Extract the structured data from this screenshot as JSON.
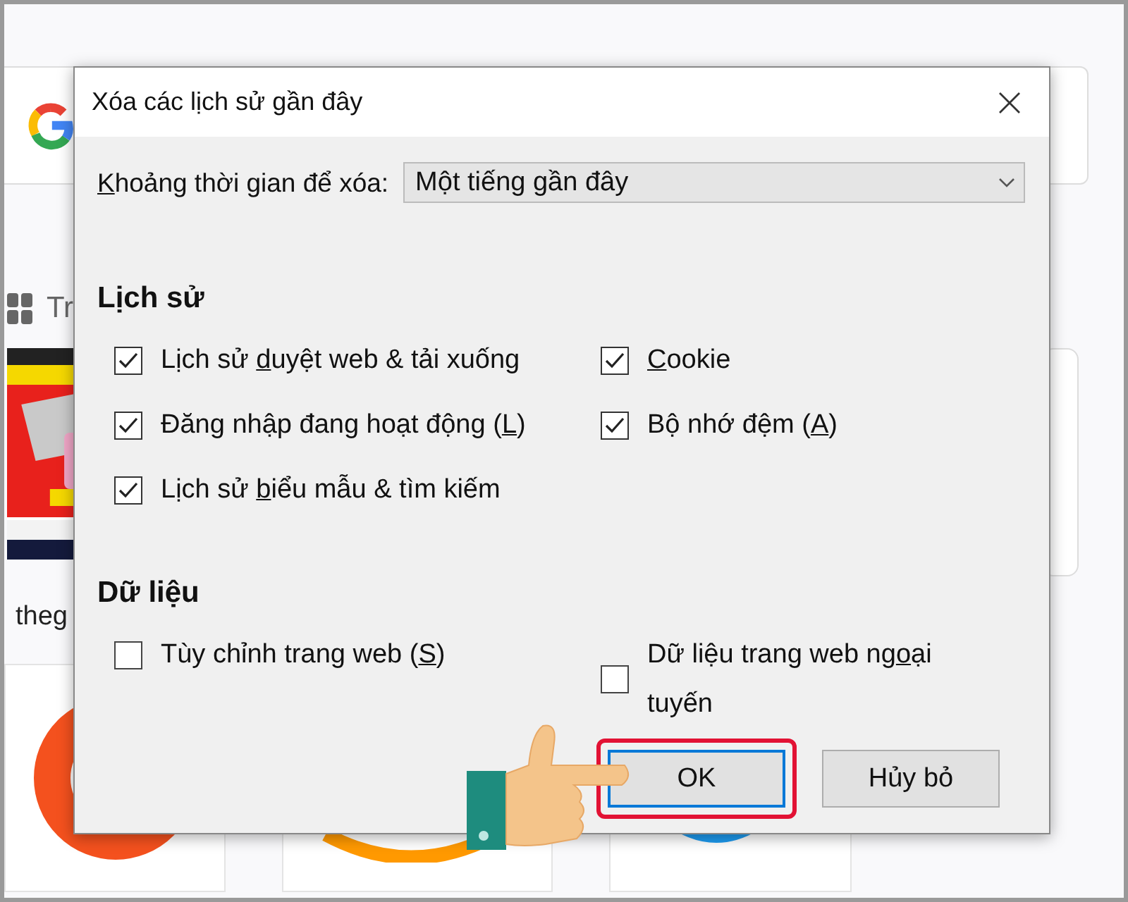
{
  "background": {
    "shortcuts_label": "Tr",
    "site_label": "theg"
  },
  "window": {
    "title": "Xóa các lịch sử gần đây"
  },
  "time_range": {
    "label": {
      "key": "K",
      "post": "hoảng thời gian để xóa:"
    },
    "value": "Một tiếng gần đây"
  },
  "sections": [
    {
      "title": "Lịch sử",
      "options": [
        {
          "label": {
            "pre": "Lịch sử ",
            "key": "d",
            "post": "uyệt web & tải xuống"
          },
          "checked": true
        },
        {
          "label": {
            "key": "C",
            "post": "ookie"
          },
          "checked": true
        },
        {
          "label": {
            "pre": "Đăng nhập đang hoạt động (",
            "key": "L",
            "post": ")"
          },
          "checked": true
        },
        {
          "label": {
            "pre": "Bộ nhớ đệm (",
            "key": "A",
            "post": ")"
          },
          "checked": true
        },
        {
          "label": {
            "pre": "Lịch sử ",
            "key": "b",
            "post": "iểu mẫu & tìm kiếm"
          },
          "checked": true
        }
      ]
    },
    {
      "title": "Dữ liệu",
      "options": [
        {
          "label": {
            "pre": "Tùy chỉnh trang web (",
            "key": "S",
            "post": ")"
          },
          "checked": false
        },
        {
          "label": {
            "pre": "Dữ liệu trang web ng",
            "key": "o",
            "post": "ại tuyến"
          },
          "checked": false
        }
      ]
    }
  ],
  "buttons": [
    {
      "label": "OK",
      "default": true,
      "highlighted": true
    },
    {
      "label": "Hủy bỏ",
      "default": false,
      "highlighted": false
    }
  ]
}
